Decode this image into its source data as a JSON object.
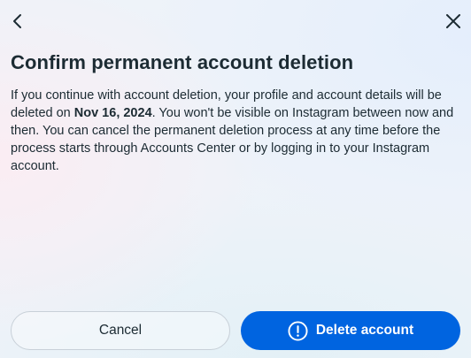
{
  "header": {
    "back_icon": "chevron-left-icon",
    "close_icon": "close-icon"
  },
  "dialog": {
    "title": "Confirm permanent account deletion",
    "description": {
      "part1": "If you continue with account deletion, your profile and account details will be deleted on ",
      "deletion_date": "Nov 16, 2024",
      "part2": ". You won't be visible on Instagram between now and then. You can cancel the permanent deletion process at any time before the process starts through Accounts Center or by logging in to your Instagram account."
    }
  },
  "actions": {
    "cancel_label": "Cancel",
    "delete_label": "Delete account",
    "delete_icon": "alert-circle-icon"
  },
  "colors": {
    "primary": "#0064e0",
    "text": "#1c2b33",
    "cancel_border": "#c8d0d8"
  }
}
